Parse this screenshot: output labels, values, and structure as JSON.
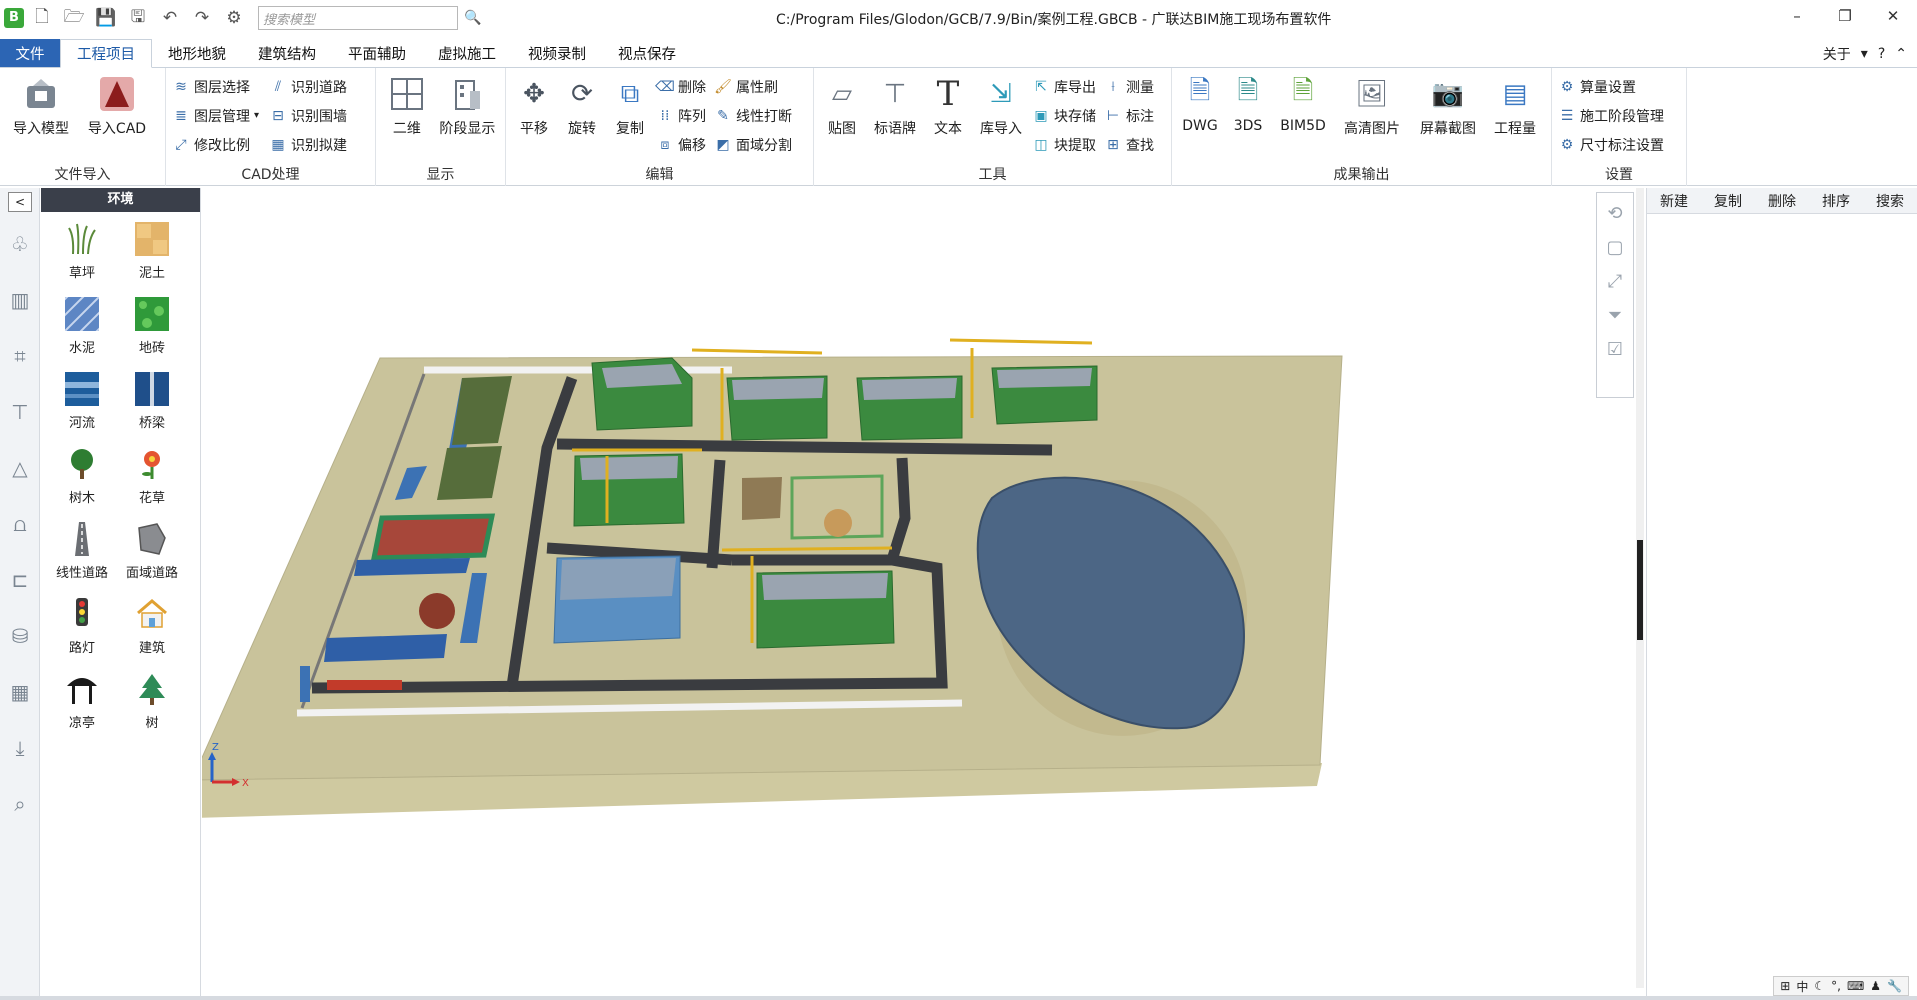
{
  "titlebar": {
    "logo": "B",
    "search_placeholder": "搜索模型",
    "title": "C:/Program Files/Glodon/GCB/7.9/Bin/案例工程.GBCB - 广联达BIM施工现场布置软件",
    "quick_icons": [
      "new-file-icon",
      "open-folder-icon",
      "save-icon",
      "save-as-icon",
      "undo-icon",
      "redo-icon",
      "settings-icon"
    ]
  },
  "menu": {
    "file": "文件",
    "tabs": [
      "工程项目",
      "地形地貌",
      "建筑结构",
      "平面辅助",
      "虚拟施工",
      "视频录制",
      "视点保存"
    ],
    "active_tab": "工程项目",
    "about": "关于"
  },
  "ribbon": {
    "file_import": {
      "label": "文件导入",
      "import_model": "导入模型",
      "import_cad": "导入CAD"
    },
    "cad": {
      "label": "CAD处理",
      "layer_select": "图层选择",
      "layer_manage": "图层管理",
      "modify_scale": "修改比例",
      "recognize_road": "识别道路",
      "recognize_wall": "识别围墙",
      "recognize_build": "识别拟建"
    },
    "display": {
      "label": "显示",
      "two_d": "二维",
      "stage_display": "阶段显示"
    },
    "edit": {
      "label": "编辑",
      "pan": "平移",
      "rotate": "旋转",
      "copy": "复制",
      "delete": "删除",
      "array": "阵列",
      "offset": "偏移",
      "attr_brush": "属性刷",
      "line_break": "线性打断",
      "area_split": "面域分割"
    },
    "tools": {
      "label": "工具",
      "sticker": "贴图",
      "sign": "标语牌",
      "text": "文本",
      "lib_import": "库导入",
      "lib_export": "库导出",
      "block_store": "块存储",
      "block_extract": "块提取",
      "measure": "测量",
      "annotate": "标注",
      "find": "查找"
    },
    "output": {
      "label": "成果输出",
      "dwg": "DWG",
      "three_ds": "3DS",
      "bim5d": "BIM5D",
      "hd_image": "高清图片",
      "screenshot": "屏幕截图",
      "quantity": "工程量"
    },
    "settings": {
      "label": "设置",
      "calc_settings": "算量设置",
      "stage_manage": "施工阶段管理",
      "dim_settings": "尺寸标注设置"
    }
  },
  "palette": {
    "title": "环境",
    "items": [
      {
        "label": "草坪",
        "icon": "grass-icon"
      },
      {
        "label": "泥土",
        "icon": "soil-icon"
      },
      {
        "label": "水泥",
        "icon": "cement-icon"
      },
      {
        "label": "地砖",
        "icon": "floor-tile-icon"
      },
      {
        "label": "河流",
        "icon": "river-icon"
      },
      {
        "label": "桥梁",
        "icon": "bridge-icon"
      },
      {
        "label": "树木",
        "icon": "tree-icon"
      },
      {
        "label": "花草",
        "icon": "flower-icon"
      },
      {
        "label": "线性道路",
        "icon": "road-icon"
      },
      {
        "label": "面域道路",
        "icon": "area-road-icon"
      },
      {
        "label": "路灯",
        "icon": "traffic-light-icon"
      },
      {
        "label": "建筑",
        "icon": "building-icon"
      },
      {
        "label": "凉亭",
        "icon": "pavilion-icon"
      },
      {
        "label": "树",
        "icon": "pine-tree-icon"
      }
    ]
  },
  "right_panel": {
    "actions": [
      "新建",
      "复制",
      "删除",
      "排序",
      "搜索"
    ]
  },
  "axis": {
    "x": "X",
    "z": "Z"
  },
  "ime": {
    "label": "中"
  },
  "colors": {
    "accent": "#2c65b4",
    "ground": "#c8c39a",
    "road": "#3a3c40",
    "lake": "#4c6685",
    "grass": "#3e7b2e"
  }
}
